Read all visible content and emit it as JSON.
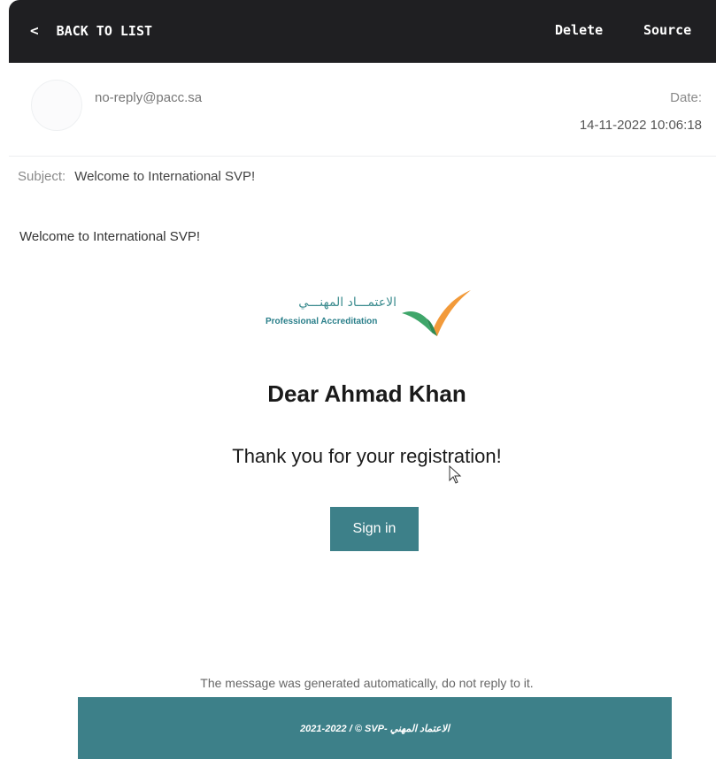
{
  "toolbar": {
    "back_label": "BACK TO LIST",
    "delete_label": "Delete",
    "source_label": "Source"
  },
  "header": {
    "from": "no-reply@pacc.sa",
    "date_label": "Date:",
    "date_value": "14-11-2022 10:06:18"
  },
  "subject": {
    "label": "Subject:",
    "value": "Welcome to International SVP!"
  },
  "body": {
    "preview": "Welcome to International SVP!",
    "logo_ar": "الاعتمـــاد المهنـــي",
    "logo_en": "Professional Accreditation",
    "greeting": "Dear Ahmad Khan",
    "thanks": "Thank you for your registration!",
    "signin_label": "Sign in",
    "auto_note": "The message was generated automatically, do not reply to it.",
    "footer_text": "2021-2022 / © SVP- الاعتماد المهني"
  },
  "colors": {
    "topbar": "#1f1f22",
    "accent": "#3d8089",
    "logo_green": "#3fa66a",
    "logo_orange": "#f29a3a"
  }
}
